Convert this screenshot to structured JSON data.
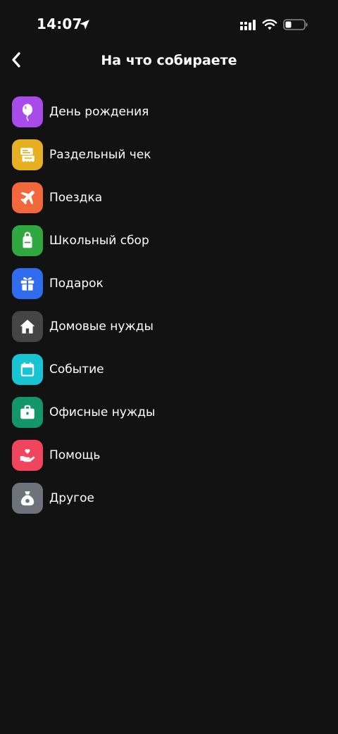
{
  "status_bar": {
    "time": "14:07"
  },
  "header": {
    "back_icon": "chevron-left-icon",
    "title": "На что собираете"
  },
  "categories": [
    {
      "label": "День рождения",
      "icon": "balloon-icon",
      "color": "#A94BEA"
    },
    {
      "label": "Раздельный чек",
      "icon": "receipt-icon",
      "color": "#E6B021"
    },
    {
      "label": "Поездка",
      "icon": "airplane-icon",
      "color": "#F2683A"
    },
    {
      "label": "Школьный сбор",
      "icon": "backpack-icon",
      "color": "#2FA840"
    },
    {
      "label": "Подарок",
      "icon": "gift-icon",
      "color": "#2F6DEE"
    },
    {
      "label": "Домовые нужды",
      "icon": "house-icon",
      "color": "#454545"
    },
    {
      "label": "Событие",
      "icon": "calendar-icon",
      "color": "#17C4D4"
    },
    {
      "label": "Офисные нужды",
      "icon": "briefcase-icon",
      "color": "#12976A"
    },
    {
      "label": "Помощь",
      "icon": "heart-hand-icon",
      "color": "#F0455C"
    },
    {
      "label": "Другое",
      "icon": "money-bag-icon",
      "color": "#6E737B"
    }
  ]
}
